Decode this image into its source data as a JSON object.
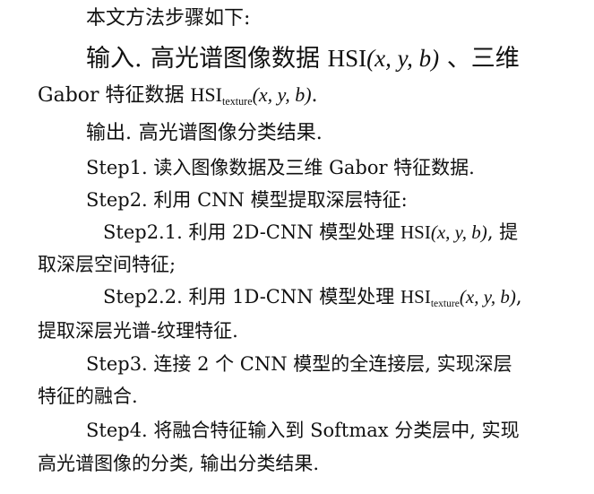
{
  "heading": "本文方法步骤如下:",
  "input": {
    "label": "输入.",
    "text1": "高光谱图像数据",
    "var1": "HSI",
    "args": "(x, y, b)",
    "sep": "、三维",
    "cont_prefix": "Gabor 特征数据",
    "var2": "HSI",
    "var2_sub": "texture",
    "end": "."
  },
  "output": {
    "label": "输出.",
    "text": "高光谱图像分类结果."
  },
  "steps": {
    "s1": "Step1. 读入图像数据及三维 Gabor 特征数据.",
    "s2": "Step2. 利用 CNN 模型提取深层特征:",
    "s21_prefix": "Step2.1. 利用 2D-CNN 模型处理",
    "s21_var": "HSI",
    "s21_args": "(x, y, b)",
    "s21_tail": ", 提",
    "s21_cont": "取深层空间特征;",
    "s22_prefix": "Step2.2. 利用 1D-CNN 模型处理",
    "s22_var": "HSI",
    "s22_sub": "texture",
    "s22_args": "(x, y, b)",
    "s22_tail": ",",
    "s22_cont": "提取深层光谱-纹理特征.",
    "s3_line1": "Step3. 连接 2 个 CNN 模型的全连接层, 实现深层",
    "s3_line2": "特征的融合.",
    "s4_line1": "Step4. 将融合特征输入到 Softmax 分类层中, 实现",
    "s4_line2": "高光谱图像的分类, 输出分类结果."
  }
}
